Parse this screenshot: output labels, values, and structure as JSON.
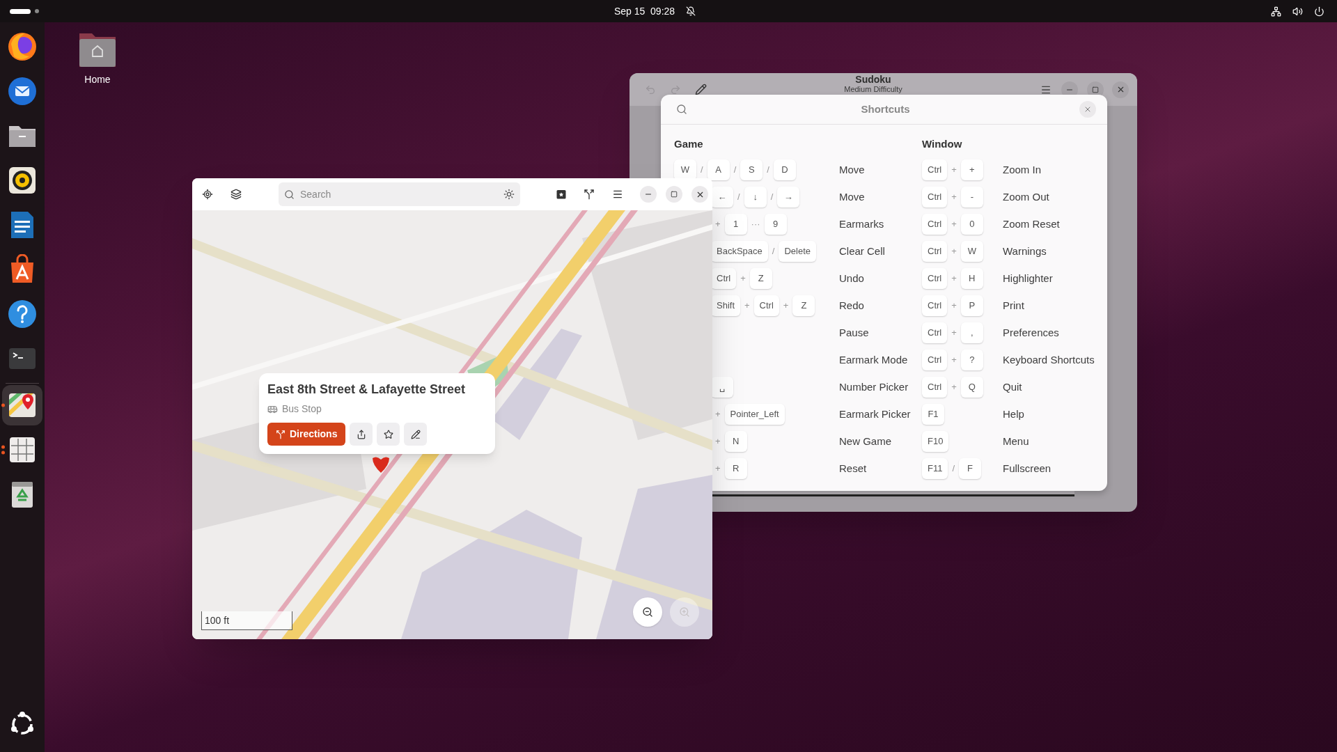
{
  "top_bar": {
    "clock": "Sep 15  09:28"
  },
  "dock": {
    "items": [
      {
        "kind": "globe",
        "running": false,
        "selected": false
      },
      {
        "kind": "mail",
        "running": false,
        "selected": false
      },
      {
        "kind": "folder",
        "running": false,
        "selected": false
      },
      {
        "kind": "speaker",
        "running": false,
        "selected": false
      },
      {
        "kind": "document",
        "running": false,
        "selected": false
      },
      {
        "kind": "bag",
        "running": false,
        "selected": false
      },
      {
        "kind": "help",
        "running": false,
        "selected": false
      },
      {
        "kind": "terminal",
        "running": false,
        "selected": false
      },
      {
        "kind": "separator"
      },
      {
        "kind": "map",
        "running": true,
        "several_windows": false,
        "selected": true
      },
      {
        "kind": "grid",
        "running": true,
        "several_windows": true,
        "selected": false
      },
      {
        "kind": "trash",
        "running": false,
        "selected": false
      }
    ]
  },
  "desktop_icons": [
    {
      "label": "Home"
    }
  ],
  "sudoku_window": {
    "title": "Sudoku",
    "subtitle": "Medium Difficulty"
  },
  "shortcuts_dialog": {
    "title": "Shortcuts",
    "sections": [
      {
        "heading": "Game",
        "rows": [
          {
            "clipped": false,
            "action": "Move",
            "keys": [
              {
                "key": "W"
              },
              {
                "sep": "/"
              },
              {
                "key": "A"
              },
              {
                "sep": "/"
              },
              {
                "key": "S"
              },
              {
                "sep": "/"
              },
              {
                "key": "D"
              }
            ]
          },
          {
            "clipped": true,
            "action": "Move",
            "keys": [
              {
                "key": "←"
              },
              {
                "sep": "/"
              },
              {
                "key": "↓"
              },
              {
                "sep": "/"
              },
              {
                "key": "→"
              }
            ]
          },
          {
            "clipped": true,
            "action": "Earmarks",
            "keys": [
              {
                "sep": "+"
              },
              {
                "key": "1"
              },
              {
                "sep": "···"
              },
              {
                "key": "9"
              }
            ]
          },
          {
            "clipped": true,
            "action": "Clear Cell",
            "keys": [
              {
                "key": "BackSpace"
              },
              {
                "sep": "/"
              },
              {
                "key": "Delete"
              }
            ]
          },
          {
            "clipped": true,
            "action": "Undo",
            "keys": [
              {
                "key": "Ctrl"
              },
              {
                "sep": "+"
              },
              {
                "key": "Z"
              }
            ]
          },
          {
            "clipped": true,
            "action": "Redo",
            "keys": [
              {
                "key": "Shift"
              },
              {
                "sep": "+"
              },
              {
                "key": "Ctrl"
              },
              {
                "sep": "+"
              },
              {
                "key": "Z"
              }
            ]
          },
          {
            "action": "Pause"
          },
          {
            "action": "Earmark Mode"
          },
          {
            "clipped": true,
            "action": "Number Picker",
            "keys": [
              {
                "key": "␣"
              }
            ]
          },
          {
            "clipped": true,
            "action": "Earmark Picker",
            "keys": [
              {
                "sep": "+"
              },
              {
                "key": "Pointer_Left"
              }
            ]
          },
          {
            "clipped": true,
            "action": "New Game",
            "keys": [
              {
                "sep": "+"
              },
              {
                "key": "N"
              }
            ]
          },
          {
            "clipped": true,
            "action": "Reset",
            "keys": [
              {
                "sep": "+"
              },
              {
                "key": "R"
              }
            ]
          }
        ]
      },
      {
        "heading": "Window",
        "rows": [
          {
            "clipped": false,
            "action": "Zoom In",
            "keys": [
              {
                "key": "Ctrl"
              },
              {
                "sep": "+"
              },
              {
                "key": "+"
              }
            ]
          },
          {
            "clipped": false,
            "action": "Zoom Out",
            "keys": [
              {
                "key": "Ctrl"
              },
              {
                "sep": "+"
              },
              {
                "key": "-"
              }
            ]
          },
          {
            "clipped": false,
            "action": "Zoom Reset",
            "keys": [
              {
                "key": "Ctrl"
              },
              {
                "sep": "+"
              },
              {
                "key": "0"
              }
            ]
          },
          {
            "clipped": false,
            "action": "Warnings",
            "keys": [
              {
                "key": "Ctrl"
              },
              {
                "sep": "+"
              },
              {
                "key": "W"
              }
            ]
          },
          {
            "clipped": false,
            "action": "Highlighter",
            "keys": [
              {
                "key": "Ctrl"
              },
              {
                "sep": "+"
              },
              {
                "key": "H"
              }
            ]
          },
          {
            "clipped": false,
            "action": "Print",
            "keys": [
              {
                "key": "Ctrl"
              },
              {
                "sep": "+"
              },
              {
                "key": "P"
              }
            ]
          },
          {
            "clipped": false,
            "action": "Preferences",
            "keys": [
              {
                "key": "Ctrl"
              },
              {
                "sep": "+"
              },
              {
                "key": ","
              }
            ]
          },
          {
            "clipped": false,
            "action": "Keyboard Shortcuts",
            "keys": [
              {
                "key": "Ctrl"
              },
              {
                "sep": "+"
              },
              {
                "key": "?"
              }
            ]
          },
          {
            "clipped": false,
            "action": "Quit",
            "keys": [
              {
                "key": "Ctrl"
              },
              {
                "sep": "+"
              },
              {
                "key": "Q"
              }
            ]
          },
          {
            "clipped": false,
            "action": "Help",
            "keys": [
              {
                "key": "F1"
              }
            ]
          },
          {
            "clipped": false,
            "action": "Menu",
            "keys": [
              {
                "key": "F10"
              }
            ]
          },
          {
            "clipped": false,
            "action": "Fullscreen",
            "keys": [
              {
                "key": "F11"
              },
              {
                "sep": "/"
              },
              {
                "key": "F"
              }
            ]
          }
        ]
      }
    ]
  },
  "maps_window": {
    "search": {
      "placeholder": "Search"
    },
    "place": {
      "name": "East 8th Street & Lafayette Street",
      "type": "Bus Stop",
      "directions": "Directions"
    },
    "scale": "100 ft",
    "zoom_out": {
      "disabled": false
    },
    "zoom_in": {
      "disabled": true
    }
  }
}
